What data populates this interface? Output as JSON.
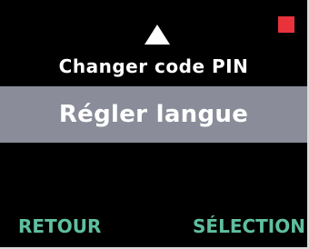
{
  "menu": {
    "previous_item": "Changer code PIN",
    "selected_item": "Régler langue"
  },
  "softkeys": {
    "left_label": "RETOUR",
    "right_label": "SÉLECTION"
  },
  "icons": {
    "scroll_up": "triangle-up-icon",
    "status": "red-square-indicator"
  },
  "colors": {
    "screen_background": "#000000",
    "text": "#ffffff",
    "selection_bar": "#8a8d99",
    "softkey_text": "#5fbf9f",
    "status_indicator": "#e8323c"
  }
}
